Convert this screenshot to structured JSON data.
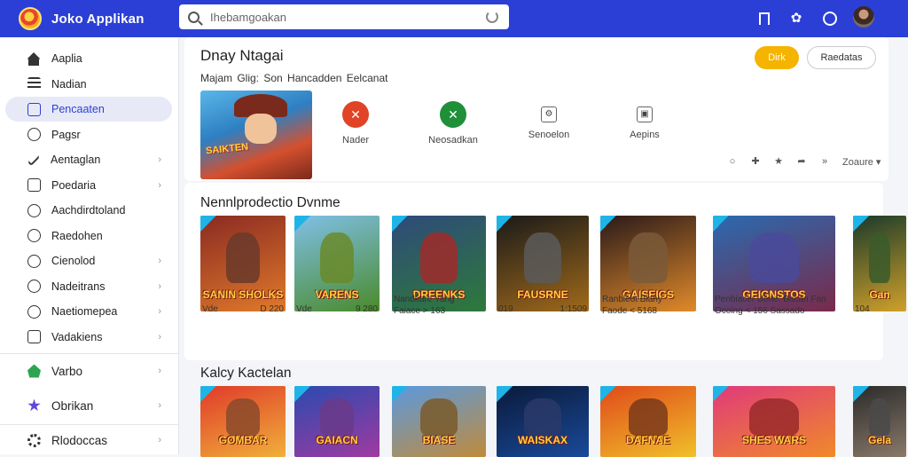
{
  "app": {
    "title": "Joko Applikan"
  },
  "search": {
    "placeholder": "Ihebamgoakan"
  },
  "sidebar": {
    "items": [
      {
        "label": "Aaplia",
        "icon": "home-icon",
        "active": false,
        "chevron": false
      },
      {
        "label": "Nadian",
        "icon": "list-icon",
        "active": false,
        "chevron": false
      },
      {
        "label": "Pencaaten",
        "icon": "square-icon",
        "active": true,
        "chevron": false
      },
      {
        "label": "Pagsr",
        "icon": "circle-icon",
        "active": false,
        "chevron": false
      },
      {
        "label": "Aentaglan",
        "icon": "pen-icon",
        "active": false,
        "chevron": true
      },
      {
        "label": "Poedaria",
        "icon": "box-icon",
        "active": false,
        "chevron": true
      },
      {
        "label": "Aachdirdtoland",
        "icon": "link-icon",
        "active": false,
        "chevron": false
      },
      {
        "label": "Raedohen",
        "icon": "clock-icon",
        "active": false,
        "chevron": false
      },
      {
        "label": "Cienolod",
        "icon": "target-icon",
        "active": false,
        "chevron": true
      },
      {
        "label": "Nadeitrans",
        "icon": "compass-icon",
        "active": false,
        "chevron": true
      },
      {
        "label": "Naetiomepea",
        "icon": "shield-icon",
        "active": false,
        "chevron": true
      },
      {
        "label": "Vadakiens",
        "icon": "check-icon",
        "active": false,
        "chevron": true
      }
    ],
    "extra": [
      {
        "label": "Varbo",
        "icon": "green-house-icon"
      },
      {
        "label": "Obrikan",
        "icon": "star-icon"
      },
      {
        "label": "Rlodoccas",
        "icon": "gear-icon"
      }
    ]
  },
  "feature": {
    "title": "Dnay Ntagai",
    "subtitle": "Majam Glig:  Son  Hancadden   Eelcanat",
    "primary_button": "Dirk",
    "secondary_button": "Raedatas",
    "hero_logo": "SAIKTEN",
    "actions": [
      {
        "label": "Nader",
        "icon": "red-badge-icon",
        "color": "#e04325",
        "glyph": "✕"
      },
      {
        "label": "Neosadkan",
        "icon": "green-cross-icon",
        "color": "#1f8f3a",
        "glyph": "✕"
      },
      {
        "label": "Senoelon",
        "icon": "cog-person-icon",
        "color": "",
        "glyph": "⚙"
      },
      {
        "label": "Aepins",
        "icon": "image-icon",
        "color": "",
        "glyph": "▣"
      }
    ],
    "zoom_label": "Zoaure"
  },
  "sections": [
    {
      "title": "Nennlprodectio Dvnme",
      "tiles": [
        {
          "title": "SANIN SHOLKS",
          "c1": "#8a2a22",
          "c2": "#e07a2a",
          "char": "#6a3a2a",
          "name": "Vde",
          "price": "D 220",
          "sub": ""
        },
        {
          "title": "VARENS",
          "c1": "#7fc0e8",
          "c2": "#4a8a2a",
          "char": "#6a8a2a",
          "name": "Vde",
          "price": "9 280",
          "sub": ""
        },
        {
          "title": "DREENKS",
          "c1": "#2e4a7a",
          "c2": "#2e7a3a",
          "char": "#a02a2a",
          "name": "Nandkare Yang",
          "price": "",
          "sub": "Faiace  >  163"
        },
        {
          "title": "FAUSRNE",
          "c1": "#1a1a1a",
          "c2": "#a06a1a",
          "char": "#5a5a5a",
          "name": "019",
          "price": "1:1509",
          "sub": ""
        },
        {
          "title": "GAISEIGS",
          "c1": "#2a1a1a",
          "c2": "#e08a2a",
          "char": "#7a5a3a",
          "name": "Ranbleot Blany",
          "price": "",
          "sub": "Faode  <  5168"
        },
        {
          "title": "GEIGNSTOS",
          "c1": "#2a6ab0",
          "c2": "#7a2a4a",
          "char": "#4a4a9a",
          "name": "Penbiacer Uene:  Bacan Fan",
          "price": "",
          "sub": "Ocoing  <  156        Sassado"
        },
        {
          "title": "Gan",
          "c1": "#1a3a2a",
          "c2": "#d0a02a",
          "char": "#3a5a2a",
          "name": "104",
          "price": "",
          "sub": ""
        }
      ]
    },
    {
      "title": "Kalcy Kactelan",
      "tiles": [
        {
          "title": "GOMBAR",
          "c1": "#e03a2a",
          "c2": "#f0b03a",
          "char": "#8a4a2a"
        },
        {
          "title": "GAIACN",
          "c1": "#2a4ab0",
          "c2": "#a03aa0",
          "char": "#6a3a8a"
        },
        {
          "title": "BIASE",
          "c1": "#5a9ae0",
          "c2": "#c08a3a",
          "char": "#7a5a2a"
        },
        {
          "title": "WAISKAX",
          "c1": "#0a1a3a",
          "c2": "#1a4a9a",
          "char": "#2a3a6a"
        },
        {
          "title": "DAFNAE",
          "c1": "#e04a1a",
          "c2": "#f0c02a",
          "char": "#7a3a1a"
        },
        {
          "title": "SHES WARS",
          "c1": "#e03a7a",
          "c2": "#f08a2a",
          "char": "#9a2a2a"
        },
        {
          "title": "Gela",
          "c1": "#2a2a2a",
          "c2": "#8a7a6a",
          "char": "#4a4a4a"
        }
      ]
    }
  ]
}
